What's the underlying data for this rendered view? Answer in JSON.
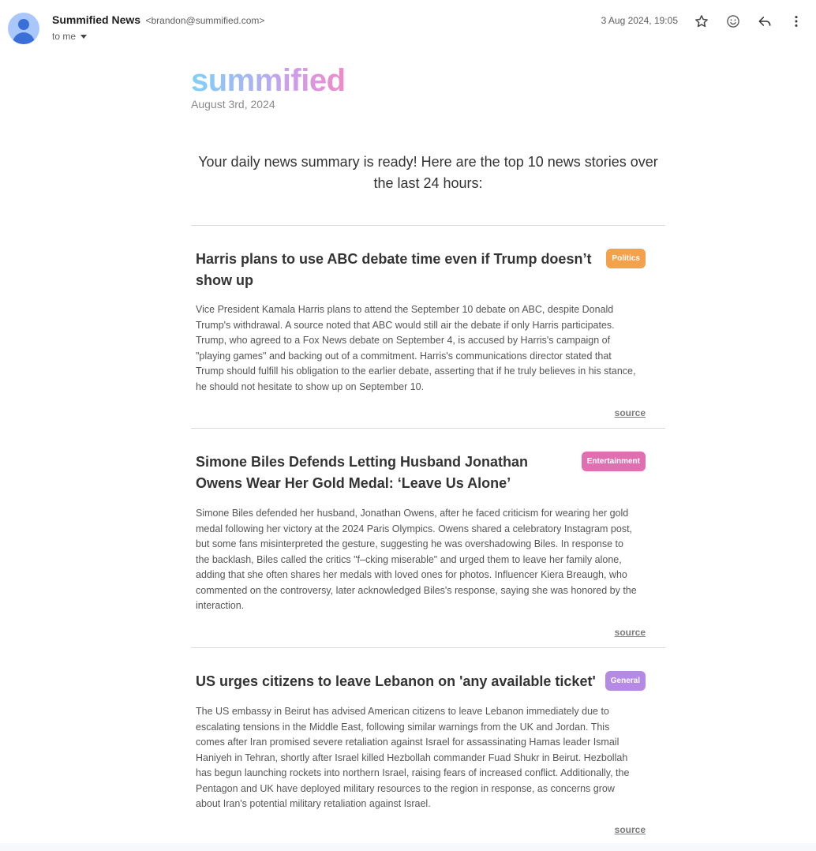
{
  "email": {
    "sender_name": "Summified News",
    "sender_email": "<brandon@summified.com>",
    "to_label": "to me",
    "date": "3 Aug 2024, 19:05",
    "icons": [
      "star-icon",
      "emoji-icon",
      "reply-icon",
      "more-vert-icon"
    ]
  },
  "newsletter": {
    "logo": "summified",
    "issue_date": "August 3rd, 2024",
    "intro": "Your daily news summary is ready! Here are the top 10 news stories over the last 24 hours:",
    "stories": [
      {
        "title": "Harris plans to use ABC debate time even if Trump doesn’t show up",
        "category": "Politics",
        "category_color": "#f5a04a",
        "summary": "Vice President Kamala Harris plans to attend the September 10 debate on ABC, despite Donald Trump's withdrawal. A source noted that ABC would still air the debate if only Harris participates. Trump, who agreed to a Fox News debate on September 4, is accused by Harris's campaign of \"playing games\" and backing out of a commitment. Harris's communications director stated that Trump should fulfill his obligation to the earlier debate, asserting that if he truly believes in his stance, he should not hesitate to show up on September 10.",
        "source_label": "source"
      },
      {
        "title": "Simone Biles Defends Letting Husband Jonathan Owens Wear Her Gold Medal: ‘Leave Us Alone’",
        "category": "Entertainment",
        "category_color": "#e06fb2",
        "summary": "Simone Biles defended her husband, Jonathan Owens, after he faced criticism for wearing her gold medal following her victory at the 2024 Paris Olympics. Owens shared a celebratory Instagram post, but some fans misinterpreted the gesture, suggesting he was overshadowing Biles. In response to the backlash, Biles called the critics \"f–cking miserable\" and urged them to leave her family alone, adding that she often shares her medals with loved ones for photos. Influencer Kiera Breaugh, who commented on the controversy, later acknowledged Biles's response, saying she was honored by the interaction.",
        "source_label": "source"
      },
      {
        "title": "US urges citizens to leave Lebanon on 'any available ticket'",
        "category": "General",
        "category_color": "#b58ae6",
        "summary": "The US embassy in Beirut has advised American citizens to leave Lebanon immediately due to escalating tensions in the Middle East, following similar warnings from the UK and Jordan. This comes after Iran promised severe retaliation against Israel for assassinating Hamas leader Ismail Haniyeh in Tehran, shortly after Israel killed Hezbollah commander Fuad Shukr in Beirut. Hezbollah has begun launching rockets into northern Israel, raising fears of increased conflict. Additionally, the Pentagon and UK have deployed military resources to the region in response, as concerns grow about Iran's potential military retaliation against Israel.",
        "source_label": "source"
      }
    ]
  }
}
